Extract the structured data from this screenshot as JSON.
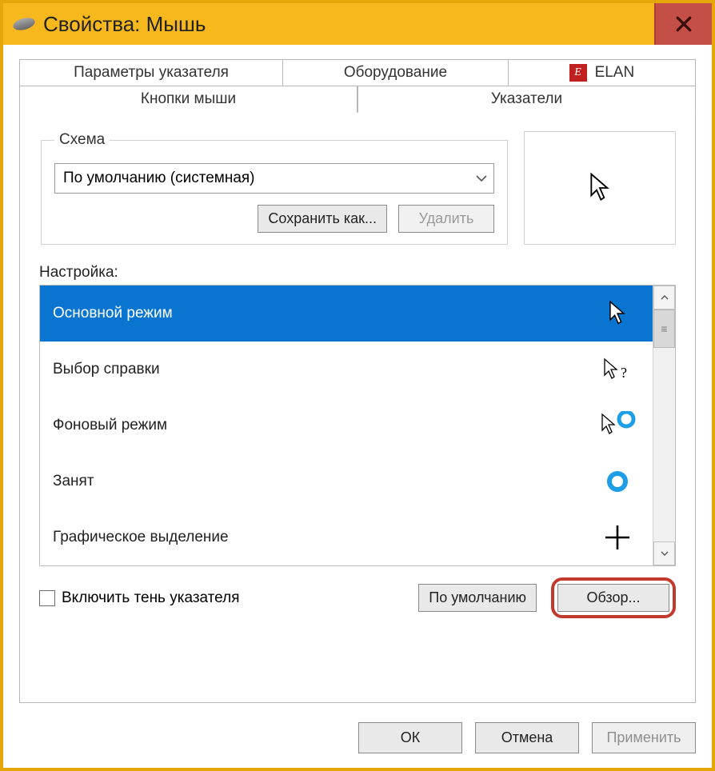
{
  "window": {
    "title": "Свойства: Мышь",
    "close": "X"
  },
  "tabs": {
    "row1": [
      "Параметры указателя",
      "Оборудование",
      "ELAN"
    ],
    "row2": {
      "inactive": "Кнопки мыши",
      "active": "Указатели"
    }
  },
  "schema": {
    "legend": "Схема",
    "selected": "По умолчанию (системная)",
    "saveAs": "Сохранить как...",
    "delete": "Удалить"
  },
  "customize": {
    "label": "Настройка:"
  },
  "list": {
    "items": [
      "Основной режим",
      "Выбор справки",
      "Фоновый режим",
      "Занят",
      "Графическое выделение"
    ]
  },
  "options": {
    "shadowCheckbox": "Включить тень указателя",
    "defaultBtn": "По умолчанию",
    "browseBtn": "Обзор..."
  },
  "dialog": {
    "ok": "ОК",
    "cancel": "Отмена",
    "apply": "Применить"
  }
}
